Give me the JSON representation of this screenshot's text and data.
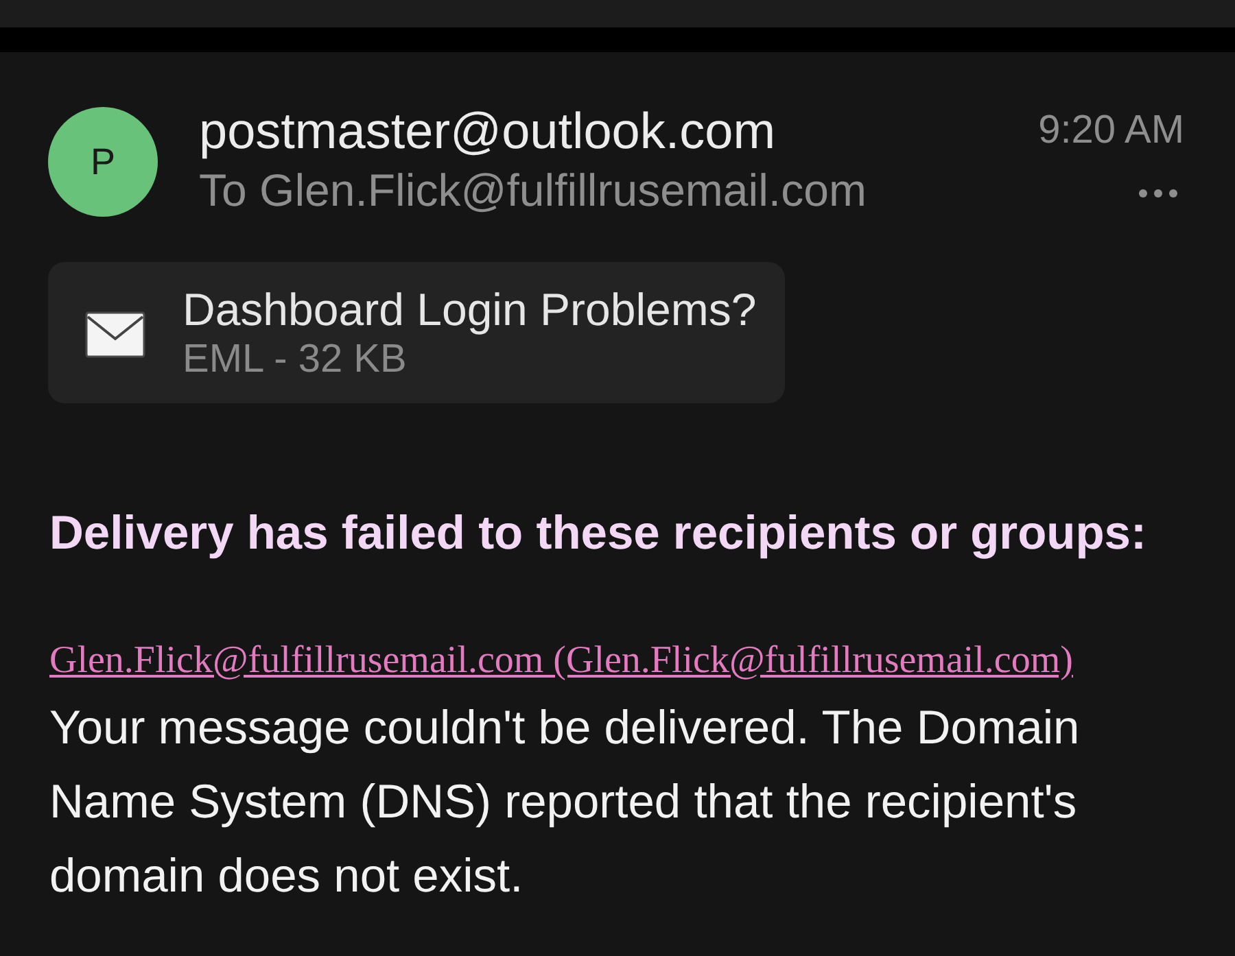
{
  "message": {
    "avatar_initial": "P",
    "sender": "postmaster@outlook.com",
    "recipient_line": "To Glen.Flick@fulfillrusemail.com",
    "time": "9:20 AM"
  },
  "attachment": {
    "name": "Dashboard Login Problems?",
    "details": "EML - 32 KB"
  },
  "body": {
    "heading": "Delivery has failed to these recipients or groups:",
    "recipient_link": "Glen.Flick@fulfillrusemail.com (Glen.Flick@fulfillrusemail.com)",
    "paragraph": "Your message couldn't be delivered. The Domain Name System (DNS) reported that the recipient's domain does not exist."
  }
}
